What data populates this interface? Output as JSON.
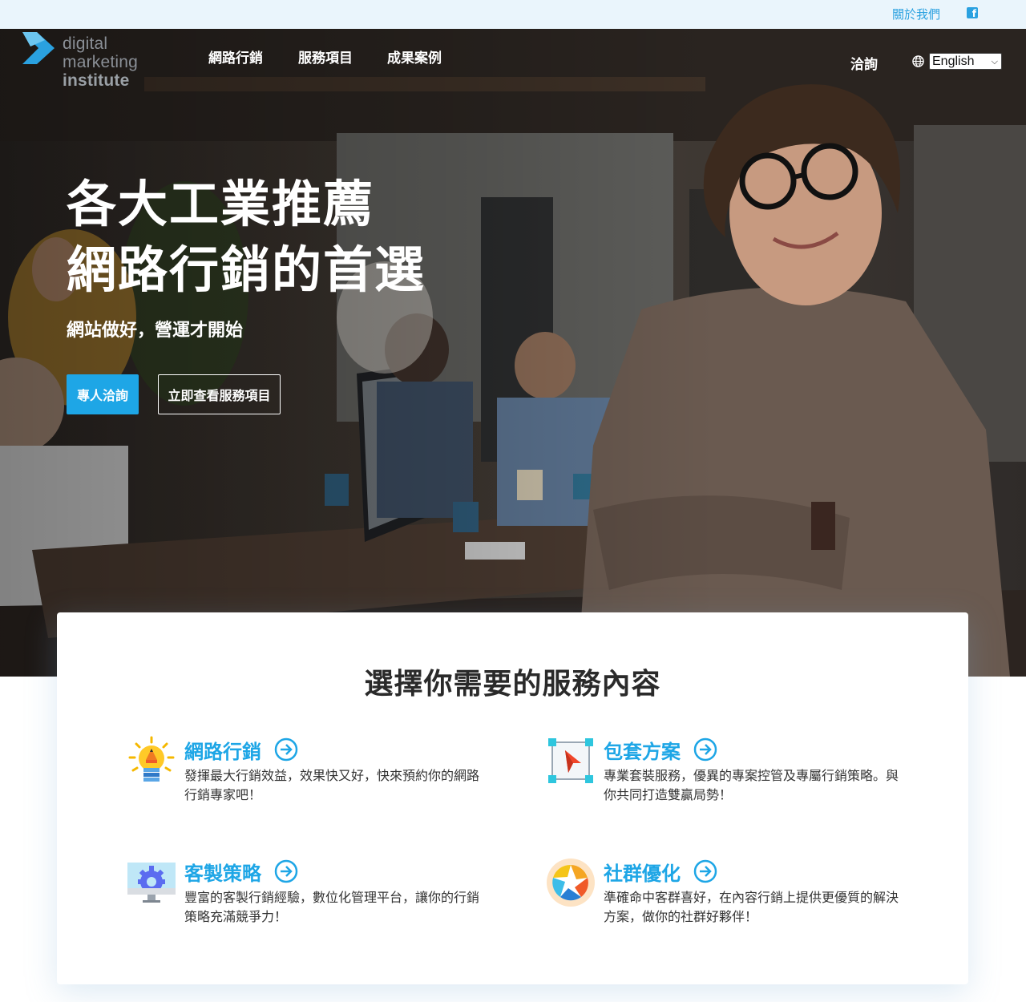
{
  "topbar": {
    "about": "關於我們",
    "facebook_icon": "facebook-icon"
  },
  "header": {
    "logo": {
      "line1": "digital",
      "line2": "marketing",
      "line3": "institute"
    },
    "nav": [
      "網路行銷",
      "服務項目",
      "成果案例"
    ],
    "consult": "洽詢",
    "language": "English"
  },
  "hero": {
    "title_line1": "各大工業推薦",
    "title_line2": "網路行銷的首選",
    "subtitle": "網站做好，營運才開始",
    "primary_button": "專人洽詢",
    "secondary_button": "立即查看服務項目"
  },
  "services": {
    "title": "選擇你需要的服務內容",
    "items": [
      {
        "name": "網路行銷",
        "desc": "發揮最大行銷效益，效果快又好，快來預約你的網路行銷專家吧！",
        "icon": "lightbulb-pencil-icon"
      },
      {
        "name": "包套方案",
        "desc": "專業套裝服務，優異的專案控管及專屬行銷策略。與你共同打造雙贏局勢！",
        "icon": "vector-cursor-icon"
      },
      {
        "name": "客製策略",
        "desc": "豐富的客製行銷經驗，數位化管理平台，讓你的行銷策略充滿競爭力！",
        "icon": "monitor-gear-icon"
      },
      {
        "name": "社群優化",
        "desc": "準確命中客群喜好，在內容行銷上提供更優質的解決方案，做你的社群好夥伴！",
        "icon": "aperture-icon"
      }
    ]
  },
  "colors": {
    "accent": "#1ea6e6",
    "topbar_bg": "#eaf5fc"
  }
}
